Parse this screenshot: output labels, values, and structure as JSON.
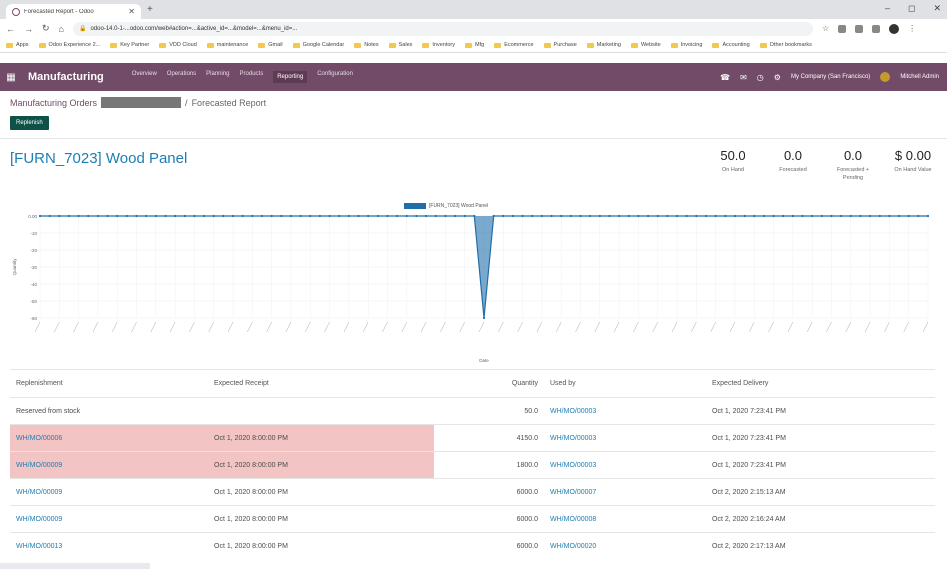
{
  "browser": {
    "tab_title": "Forecasted Report - Odoo",
    "url": "odoo-14.0-1-...odoo.com/web#action=...&active_id=...&model=...&menu_id=...",
    "bookmarks": [
      "Apps",
      "Odoo Experience 2...",
      "Key Partner",
      "VDD Cloud",
      "maintenance",
      "Gmail",
      "Google Calendar",
      "Notes",
      "Sales",
      "Inventory",
      "Mfg",
      "Ecommerce",
      "Purchase",
      "Marketing",
      "Website",
      "Invoicing",
      "Accounting",
      "Other bookmarks"
    ]
  },
  "navbar": {
    "app_name": "Manufacturing",
    "menu": [
      "Overview",
      "Operations",
      "Planning",
      "Products",
      "Reporting",
      "Configuration"
    ],
    "company": "My Company (San Francisco)",
    "user": "Mitchell Admin"
  },
  "breadcrumb": {
    "root": "Manufacturing Orders",
    "current": "Forecasted Report"
  },
  "replenish_label": "Replenish",
  "product": {
    "title": "[FURN_7023] Wood Panel"
  },
  "kpis": [
    {
      "value": "50.0",
      "label": "On Hand"
    },
    {
      "value": "0.0",
      "label": "Forecasted"
    },
    {
      "value": "0.0",
      "label": "Forecasted + Pending"
    },
    {
      "value": "$ 0.00",
      "label": "On Hand Value"
    }
  ],
  "chart_data": {
    "type": "line",
    "series": [
      {
        "name": "[FURN_7023] Wood Panel",
        "color": "#1f6fab"
      }
    ],
    "ylabel": "Quantity",
    "xlabel": "Date",
    "ytick_labels": [
      "0.00",
      "-10",
      "-20",
      "-30",
      "-40",
      "-50",
      "-60"
    ],
    "y_top": 0.0,
    "y_dip": -60,
    "dip_index": 46,
    "num_points": 93,
    "grid": true,
    "legend": "top"
  },
  "table": {
    "headers": [
      "Replenishment",
      "Expected Receipt",
      "Quantity",
      "Used by",
      "Expected Delivery"
    ],
    "rows": [
      {
        "replenishment": "Reserved from stock",
        "receipt": "",
        "quantity": "50.0",
        "used_by": "WH/MO/00003",
        "delivery": "Oct 1, 2020 7:23:41 PM",
        "link": false,
        "highlight": false
      },
      {
        "replenishment": "WH/MO/00006",
        "receipt": "Oct 1, 2020 8:00:00 PM",
        "quantity": "4150.0",
        "used_by": "WH/MO/00003",
        "delivery": "Oct 1, 2020 7:23:41 PM",
        "link": true,
        "highlight": true
      },
      {
        "replenishment": "WH/MO/00009",
        "receipt": "Oct 1, 2020 8:00:00 PM",
        "quantity": "1800.0",
        "used_by": "WH/MO/00003",
        "delivery": "Oct 1, 2020 7:23:41 PM",
        "link": true,
        "highlight": true
      },
      {
        "replenishment": "WH/MO/00009",
        "receipt": "Oct 1, 2020 8:00:00 PM",
        "quantity": "6000.0",
        "used_by": "WH/MO/00007",
        "delivery": "Oct 2, 2020 2:15:13 AM",
        "link": true,
        "highlight": false
      },
      {
        "replenishment": "WH/MO/00009",
        "receipt": "Oct 1, 2020 8:00:00 PM",
        "quantity": "6000.0",
        "used_by": "WH/MO/00008",
        "delivery": "Oct 2, 2020 2:16:24 AM",
        "link": true,
        "highlight": false
      },
      {
        "replenishment": "WH/MO/00013",
        "receipt": "Oct 1, 2020 8:00:00 PM",
        "quantity": "6000.0",
        "used_by": "WH/MO/00020",
        "delivery": "Oct 2, 2020 2:17:13 AM",
        "link": true,
        "highlight": false
      }
    ]
  }
}
